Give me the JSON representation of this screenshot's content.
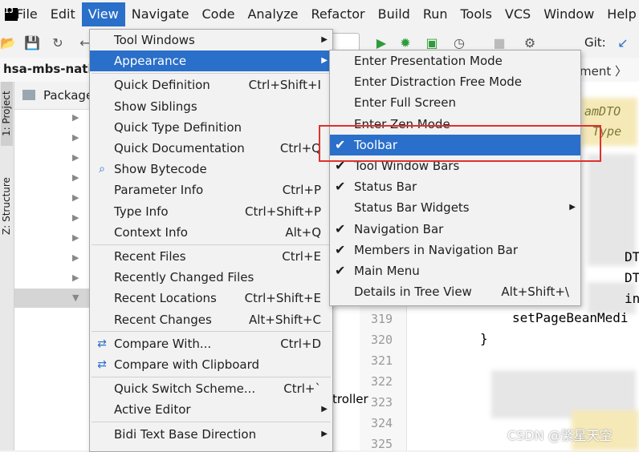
{
  "menubar": {
    "items": [
      "File",
      "Edit",
      "View",
      "Navigate",
      "Code",
      "Analyze",
      "Refactor",
      "Build",
      "Run",
      "Tools",
      "VCS",
      "Window",
      "Help"
    ],
    "active": "View"
  },
  "toolbar": {
    "run_config": "n",
    "git_label": "Git:"
  },
  "navbar": {
    "project": "hsa-mbs-natio",
    "crumb": "ment 〉co"
  },
  "left_strip": {
    "project_tab": "1: Project",
    "structure_tab": "Z: Structure"
  },
  "project_panel": {
    "header": "Package"
  },
  "view_menu": {
    "groups": [
      [
        {
          "label": "Tool Windows",
          "shortcut": "",
          "submenu": true
        },
        {
          "label": "Appearance",
          "shortcut": "",
          "submenu": true,
          "highlighted": true
        }
      ],
      [
        {
          "label": "Quick Definition",
          "shortcut": "Ctrl+Shift+I"
        },
        {
          "label": "Show Siblings",
          "shortcut": ""
        },
        {
          "label": "Quick Type Definition",
          "shortcut": ""
        },
        {
          "label": "Quick Documentation",
          "shortcut": "Ctrl+Q"
        },
        {
          "label": "Show Bytecode",
          "shortcut": "",
          "icon": "bytecode-search-icon"
        },
        {
          "label": "Parameter Info",
          "shortcut": "Ctrl+P"
        },
        {
          "label": "Type Info",
          "shortcut": "Ctrl+Shift+P"
        },
        {
          "label": "Context Info",
          "shortcut": "Alt+Q"
        }
      ],
      [
        {
          "label": "Recent Files",
          "shortcut": "Ctrl+E"
        },
        {
          "label": "Recently Changed Files",
          "shortcut": ""
        },
        {
          "label": "Recent Locations",
          "shortcut": "Ctrl+Shift+E"
        },
        {
          "label": "Recent Changes",
          "shortcut": "Alt+Shift+C"
        }
      ],
      [
        {
          "label": "Compare With...",
          "shortcut": "Ctrl+D",
          "icon": "compare-icon"
        },
        {
          "label": "Compare with Clipboard",
          "shortcut": "",
          "icon": "compare-clipboard-icon"
        }
      ],
      [
        {
          "label": "Quick Switch Scheme...",
          "shortcut": "Ctrl+`"
        },
        {
          "label": "Active Editor",
          "shortcut": "",
          "submenu": true
        }
      ],
      [
        {
          "label": "Bidi Text Base Direction",
          "shortcut": "",
          "submenu": true
        }
      ]
    ]
  },
  "appearance_menu": {
    "items": [
      {
        "label": "Enter Presentation Mode",
        "checked": false
      },
      {
        "label": "Enter Distraction Free Mode",
        "checked": false
      },
      {
        "label": "Enter Full Screen",
        "checked": false
      },
      {
        "label": "Enter Zen Mode",
        "checked": false
      },
      {
        "label": "Toolbar",
        "checked": true,
        "highlighted": true
      },
      {
        "label": "Tool Window Bars",
        "checked": true
      },
      {
        "label": "Status Bar",
        "checked": true
      },
      {
        "label": "Status Bar Widgets",
        "checked": false,
        "submenu": true
      },
      {
        "label": "Navigation Bar",
        "checked": true
      },
      {
        "label": "Members in Navigation Bar",
        "checked": true
      },
      {
        "label": "Main Menu",
        "checked": true
      },
      {
        "label": "Details in Tree View",
        "checked": false,
        "shortcut": "Alt+Shift+\\"
      }
    ]
  },
  "editor": {
    "line_numbers": [
      "319",
      "320",
      "321",
      "322",
      "323",
      "324",
      "325"
    ],
    "code_lines": [
      "setPageBeanMedi",
      "}"
    ],
    "fragments": [
      "amDTO",
      "Type",
      "DT",
      "DT",
      "in",
      "troller"
    ]
  },
  "watermark": "CSDN @繁星天空",
  "colors": {
    "accent": "#2a6fc9",
    "highlight_box": "#e03030",
    "menu_bg": "#f2f2f2"
  }
}
